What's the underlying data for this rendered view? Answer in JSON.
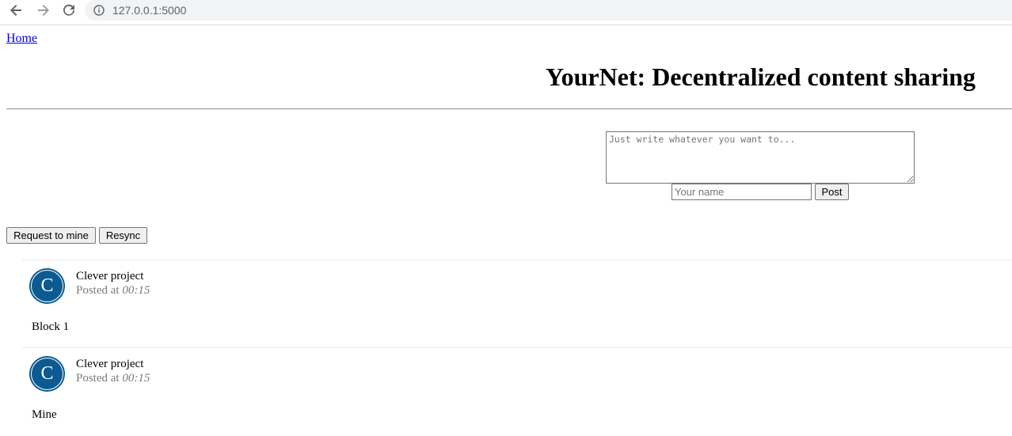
{
  "browser": {
    "url": "127.0.0.1:5000",
    "back_icon": "arrow-left",
    "forward_icon": "arrow-right",
    "reload_icon": "reload",
    "info_icon": "info-circle"
  },
  "nav": {
    "home_label": "Home"
  },
  "page": {
    "title": "YourNet: Decentralized content sharing"
  },
  "compose": {
    "content_placeholder": "Just write whatever you want to...",
    "content_value": "",
    "name_placeholder": "Your name",
    "name_value": "",
    "post_label": "Post"
  },
  "actions": {
    "request_label": "Request to mine",
    "resync_label": "Resync"
  },
  "posts": [
    {
      "avatar_letter": "C",
      "author": "Clever project",
      "posted_prefix": "Posted at",
      "time": "00:15",
      "content": "Block 1"
    },
    {
      "avatar_letter": "C",
      "author": "Clever project",
      "posted_prefix": "Posted at",
      "time": "00:15",
      "content": "Mine"
    }
  ],
  "colors": {
    "avatar_bg": "#0b5a91",
    "link": "#0000ee"
  }
}
